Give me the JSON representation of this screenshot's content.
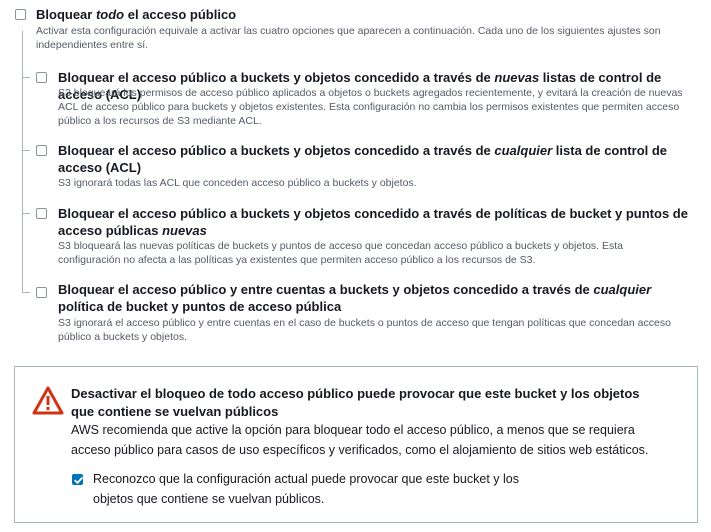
{
  "block_all": {
    "title_pre": "Bloquear ",
    "title_em": "todo",
    "title_post": " el acceso público",
    "description": "Activar esta configuración equivale a activar las cuatro opciones que aparecen a continuación. Cada uno de los siguientes ajustes son independientes entre sí.",
    "checked": false
  },
  "options": [
    {
      "title_pre": "Bloquear el acceso público a buckets y objetos concedido a través de ",
      "title_em": "nuevas",
      "title_post": " listas de control de acceso (ACL)",
      "description": "S3 bloqueará los permisos de acceso público aplicados a objetos o buckets agregados recientemente, y evitará la creación de nuevas ACL de acceso público para buckets y objetos existentes. Esta configuración no cambia los permisos existentes que permiten acceso público a los recursos de S3 mediante ACL.",
      "checked": false
    },
    {
      "title_pre": "Bloquear el acceso público a buckets y objetos concedido a través de ",
      "title_em": "cualquier",
      "title_post": " lista de control de acceso (ACL)",
      "description": "S3 ignorará todas las ACL que conceden acceso público a buckets y objetos.",
      "checked": false
    },
    {
      "title_pre": "Bloquear el acceso público a buckets y objetos concedido a través de políticas de bucket y puntos de acceso públicas ",
      "title_em": "nuevas",
      "title_post": "",
      "description": "S3 bloqueará las nuevas políticas de buckets y puntos de acceso que concedan acceso público a buckets y objetos. Esta configuración no afecta a las políticas ya existentes que permiten acceso público a los recursos de S3.",
      "checked": false
    },
    {
      "title_pre": "Bloquear el acceso público y entre cuentas a buckets y objetos concedido a través de ",
      "title_em": "cualquier",
      "title_post": " política de bucket y puntos de acceso pública",
      "description": "S3 ignorará el acceso público y entre cuentas en el caso de buckets o puntos de acceso que tengan políticas que concedan acceso público a buckets y objetos.",
      "checked": false
    }
  ],
  "warning": {
    "icon": "warning-triangle-icon",
    "color": "#d13212",
    "title": "Desactivar el bloqueo de todo acceso público puede provocar que este bucket y los objetos que contiene se vuelvan públicos",
    "body": "AWS recomienda que active la opción para bloquear todo el acceso público, a menos que se requiera acceso público para casos de uso específicos y verificados, como el alojamiento de sitios web estáticos.",
    "ack_label": "Reconozco que la configuración actual puede provocar que este bucket y los objetos que contiene se vuelvan públicos.",
    "ack_checked": true
  },
  "colors": {
    "accent": "#0073bb",
    "warning": "#d13212",
    "text": "#16191f",
    "secondary_text": "#545b64"
  }
}
